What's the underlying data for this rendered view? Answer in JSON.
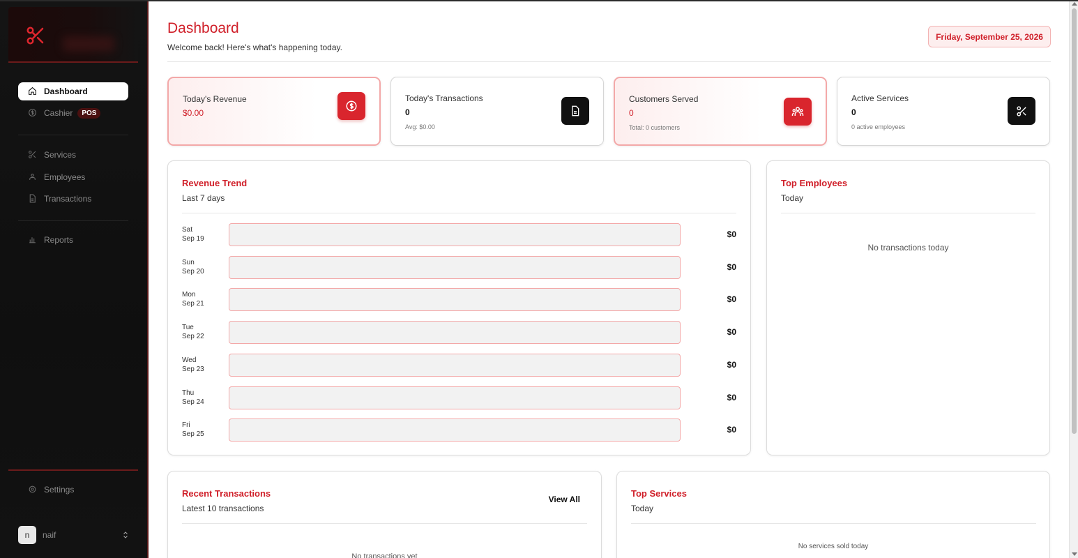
{
  "sidebar": {
    "nav": [
      {
        "label": "Dashboard",
        "icon": "home-icon"
      },
      {
        "label": "Cashier",
        "badge": "POS",
        "icon": "dollar-icon"
      },
      {
        "label": "Services",
        "icon": "scissors-icon"
      },
      {
        "label": "Employees",
        "icon": "employees-icon"
      },
      {
        "label": "Transactions",
        "icon": "document-icon"
      },
      {
        "label": "Reports",
        "icon": "bar-chart-icon"
      }
    ],
    "settings": {
      "label": "Settings",
      "icon": "gear-icon"
    },
    "user": {
      "initial": "n",
      "name": "naif"
    }
  },
  "header": {
    "title": "Dashboard",
    "subtitle": "Welcome back! Here's what's happening today.",
    "date": "Friday, September 25, 2026"
  },
  "stats": [
    {
      "label": "Today's Revenue",
      "value": "$0.00",
      "sub": "",
      "icon": "dollar-circle-icon"
    },
    {
      "label": "Today's Transactions",
      "value": "0",
      "sub": "Avg: $0.00",
      "icon": "document-icon"
    },
    {
      "label": "Customers Served",
      "value": "0",
      "sub": "Total: 0 customers",
      "icon": "users-icon"
    },
    {
      "label": "Active Services",
      "value": "0",
      "sub": "0 active employees",
      "icon": "scissors-icon"
    }
  ],
  "revenue_trend": {
    "title": "Revenue Trend",
    "subtitle": "Last 7 days",
    "rows": [
      {
        "day": "Sat",
        "date": "Sep 19",
        "amount": "$0",
        "fraction": 0
      },
      {
        "day": "Sun",
        "date": "Sep 20",
        "amount": "$0",
        "fraction": 0
      },
      {
        "day": "Mon",
        "date": "Sep 21",
        "amount": "$0",
        "fraction": 0
      },
      {
        "day": "Tue",
        "date": "Sep 22",
        "amount": "$0",
        "fraction": 0
      },
      {
        "day": "Wed",
        "date": "Sep 23",
        "amount": "$0",
        "fraction": 0
      },
      {
        "day": "Thu",
        "date": "Sep 24",
        "amount": "$0",
        "fraction": 0
      },
      {
        "day": "Fri",
        "date": "Sep 25",
        "amount": "$0",
        "fraction": 0
      }
    ]
  },
  "top_employees": {
    "title": "Top Employees",
    "subtitle": "Today",
    "empty": "No transactions today"
  },
  "recent_transactions": {
    "title": "Recent Transactions",
    "subtitle": "Latest 10 transactions",
    "view_all": "View All",
    "empty": "No transactions yet"
  },
  "top_services": {
    "title": "Top Services",
    "subtitle": "Today",
    "empty": "No services sold today"
  },
  "colors": {
    "accent": "#d0202a",
    "sidebar_bg": "#111111"
  }
}
